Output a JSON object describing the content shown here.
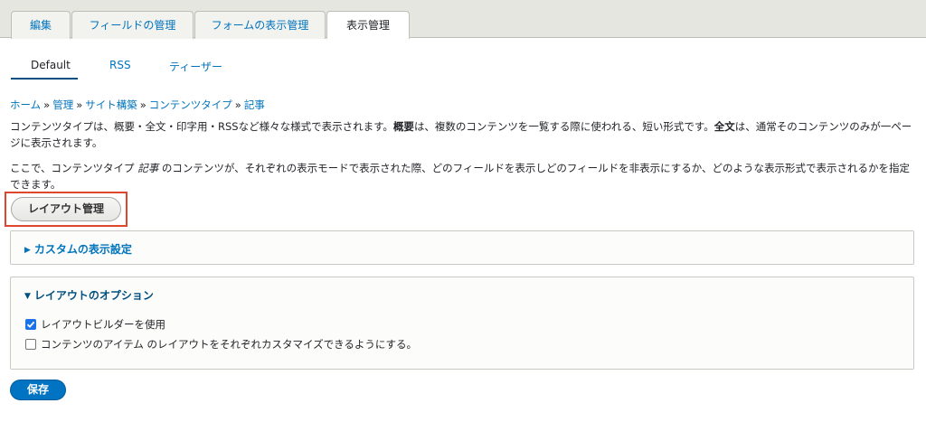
{
  "primary_tabs": [
    {
      "label": "編集"
    },
    {
      "label": "フィールドの管理"
    },
    {
      "label": "フォームの表示管理"
    },
    {
      "label": "表示管理"
    }
  ],
  "secondary_tabs": [
    {
      "label": "Default"
    },
    {
      "label": "RSS"
    },
    {
      "label": "ティーザー"
    }
  ],
  "breadcrumb": [
    {
      "label": "ホーム"
    },
    {
      "label": "管理"
    },
    {
      "label": "サイト構築"
    },
    {
      "label": "コンテンツタイプ"
    },
    {
      "label": "記事"
    }
  ],
  "breadcrumb_separator": "»",
  "description": {
    "p1_a": "コンテンツタイプは、概要・全文・印字用・RSSなど様々な様式で表示されます。",
    "p1_b": "概要",
    "p1_c": "は、複数のコンテンツを一覧する際に使われる、短い形式です。",
    "p1_d": "全文",
    "p1_e": "は、通常そのコンテンツのみが一ページに表示されます。",
    "p2_a": "ここで、コンテンツタイプ ",
    "p2_b": "記事",
    "p2_c": " のコンテンツが、それぞれの表示モードで表示された際、どのフィールドを表示しどのフィールドを非表示にするか、どのような表示形式で表示されるかを指定できます。"
  },
  "layout_button": {
    "label": "レイアウト管理"
  },
  "custom_display": {
    "label": "カスタムの表示設定",
    "triangle": "▶"
  },
  "layout_options": {
    "label": "レイアウトのオプション",
    "triangle": "▼",
    "use_layout_builder": {
      "label": "レイアウトビルダーを使用",
      "checked": true
    },
    "per_item_layout": {
      "label": "コンテンツのアイテム のレイアウトをそれぞれカスタマイズできるようにする。",
      "checked": false
    }
  },
  "save_button": {
    "label": "保存"
  },
  "colors": {
    "link": "#0074bd",
    "primary_button": "#0073c2",
    "highlight": "#e0452d",
    "checkbox": "#1a73e8"
  }
}
